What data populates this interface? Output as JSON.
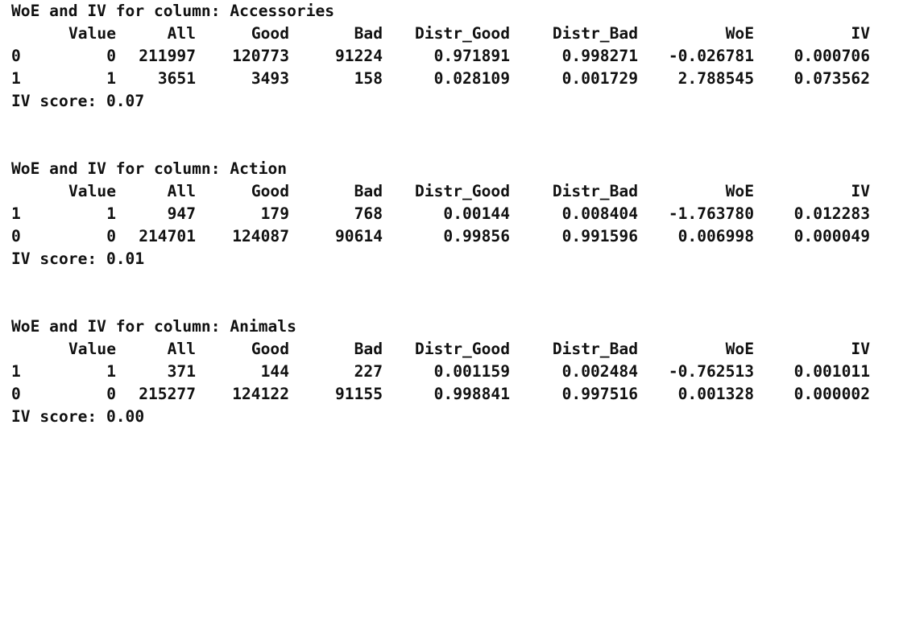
{
  "tables": [
    {
      "title": "WoE and IV for column: Accessories",
      "headers": [
        "Value",
        "All",
        "Good",
        "Bad",
        "Distr_Good",
        "Distr_Bad",
        "WoE",
        "IV"
      ],
      "rows": [
        {
          "index": "0",
          "cells": [
            "0",
            "211997",
            "120773",
            "91224",
            "0.971891",
            "0.998271",
            "-0.026781",
            "0.000706"
          ]
        },
        {
          "index": "1",
          "cells": [
            "1",
            "3651",
            "3493",
            "158",
            "0.028109",
            "0.001729",
            "2.788545",
            "0.073562"
          ]
        }
      ],
      "score": "IV score: 0.07"
    },
    {
      "title": "WoE and IV for column: Action",
      "headers": [
        "Value",
        "All",
        "Good",
        "Bad",
        "Distr_Good",
        "Distr_Bad",
        "WoE",
        "IV"
      ],
      "rows": [
        {
          "index": "1",
          "cells": [
            "1",
            "947",
            "179",
            "768",
            "0.00144",
            "0.008404",
            "-1.763780",
            "0.012283"
          ]
        },
        {
          "index": "0",
          "cells": [
            "0",
            "214701",
            "124087",
            "90614",
            "0.99856",
            "0.991596",
            "0.006998",
            "0.000049"
          ]
        }
      ],
      "score": "IV score: 0.01"
    },
    {
      "title": "WoE and IV for column: Animals",
      "headers": [
        "Value",
        "All",
        "Good",
        "Bad",
        "Distr_Good",
        "Distr_Bad",
        "WoE",
        "IV"
      ],
      "rows": [
        {
          "index": "1",
          "cells": [
            "1",
            "371",
            "144",
            "227",
            "0.001159",
            "0.002484",
            "-0.762513",
            "0.001011"
          ]
        },
        {
          "index": "0",
          "cells": [
            "0",
            "215277",
            "124122",
            "91155",
            "0.998841",
            "0.997516",
            "0.001328",
            "0.000002"
          ]
        }
      ],
      "score": "IV score: 0.00"
    }
  ]
}
